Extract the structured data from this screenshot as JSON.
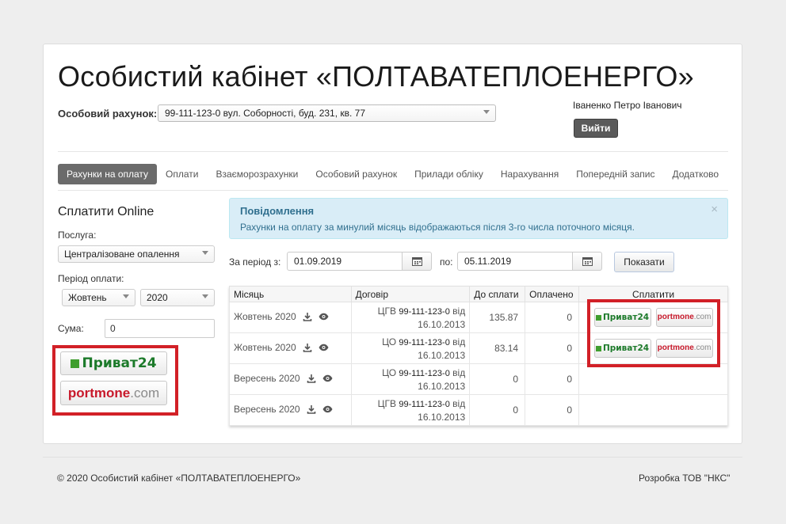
{
  "header": {
    "title": "Особистий кабінет «ПОЛТАВАТЕПЛОЕНЕРГО»",
    "account_label": "Особовий рахунок:",
    "account_value": "99-111-123-0 вул. Соборності, буд. 231, кв. 77",
    "user_name": "Іваненко Петро Іванович",
    "logout_label": "Вийти"
  },
  "nav": {
    "items": [
      {
        "label": "Рахунки на оплату",
        "active": true
      },
      {
        "label": "Оплати"
      },
      {
        "label": "Взаєморозрахунки"
      },
      {
        "label": "Особовий рахунок"
      },
      {
        "label": "Прилади обліку"
      },
      {
        "label": "Нарахування"
      },
      {
        "label": "Попередній запис"
      },
      {
        "label": "Додатково"
      }
    ]
  },
  "pay_online": {
    "title": "Сплатити Online",
    "service_label": "Послуга:",
    "service_value": "Централізоване опалення",
    "period_label": "Період оплати:",
    "month_value": "Жовтень",
    "year_value": "2020",
    "sum_label": "Сума:",
    "sum_value": "0"
  },
  "payment_logos": {
    "privat": "Приват24",
    "portmone_main": "portmone",
    "portmone_suffix": ".com"
  },
  "alert": {
    "title": "Повідомлення",
    "text": "Рахунки на оплату за минулий місяць відображаються після 3-го числа поточного місяця.",
    "close": "×"
  },
  "period": {
    "from_label": "За період з:",
    "from_value": "01.09.2019",
    "to_label": "по:",
    "to_value": "05.11.2019",
    "show_label": "Показати"
  },
  "table": {
    "headers": [
      "Місяць",
      "Договір",
      "До сплати",
      "Оплачено",
      "Сплатити"
    ],
    "rows": [
      {
        "month": "Жовтень 2020",
        "type": "ЦГВ",
        "number": "99-111-123-0",
        "from": "від",
        "date": "16.10.2013",
        "due": "135.87",
        "paid": "0",
        "pay": true
      },
      {
        "month": "Жовтень 2020",
        "type": "ЦО",
        "number": "99-111-123-0",
        "from": "від",
        "date": "16.10.2013",
        "due": "83.14",
        "paid": "0",
        "pay": true
      },
      {
        "month": "Вересень 2020",
        "type": "ЦО",
        "number": "99-111-123-0",
        "from": "від",
        "date": "16.10.2013",
        "due": "0",
        "paid": "0",
        "pay": false
      },
      {
        "month": "Вересень 2020",
        "type": "ЦГВ",
        "number": "99-111-123-0",
        "from": "від",
        "date": "16.10.2013",
        "due": "0",
        "paid": "0",
        "pay": false
      }
    ]
  },
  "footer": {
    "copyright": "© 2020 Особистий кабінет «ПОЛТАВАТЕПЛОЕНЕРГО»",
    "developer": "Розробка ТОВ \"НКС\""
  },
  "colors": {
    "active_nav": "#6b6b6b",
    "alert_bg": "#d9edf7",
    "alert_text": "#31708f",
    "highlight_red": "#d22027",
    "privat_green": "#3f9e2e",
    "portmone_red": "#c8192b"
  },
  "icons": [
    "download-icon",
    "eye-icon",
    "calendar-icon",
    "close-icon",
    "chevron-down-icon"
  ]
}
